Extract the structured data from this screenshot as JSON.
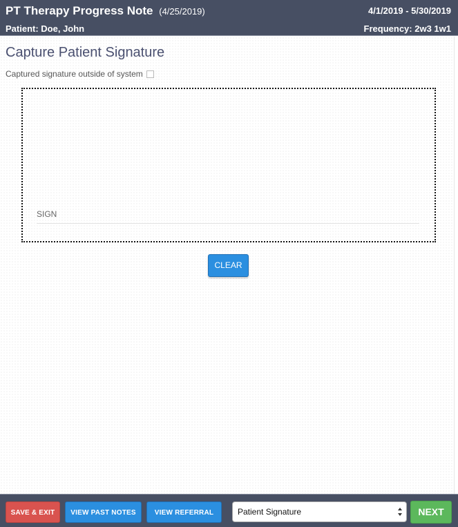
{
  "header": {
    "title": "PT Therapy Progress Note",
    "note_date": "(4/25/2019)",
    "date_range": "4/1/2019 - 5/30/2019",
    "patient": "Patient: Doe, John",
    "frequency": "Frequency: 2w3 1w1"
  },
  "main": {
    "heading": "Capture Patient Signature",
    "outside_label": "Captured signature outside of system",
    "outside_checked": false,
    "signature": {
      "label": "SIGN"
    },
    "clear_label": "CLEAR"
  },
  "footer": {
    "save_exit_label": "SAVE & EXIT",
    "view_past_notes_label": "VIEW PAST NOTES",
    "view_referral_label": "VIEW REFERRAL",
    "section_select_value": "Patient Signature",
    "next_label": "NEXT"
  },
  "colors": {
    "header_bg": "#474f63",
    "primary_blue": "#2b8fe0",
    "danger_red": "#d9534f",
    "success_green": "#5cb85c",
    "heading_text": "#4a5070"
  },
  "icons": {
    "select_arrows": "updown-arrows-icon"
  }
}
